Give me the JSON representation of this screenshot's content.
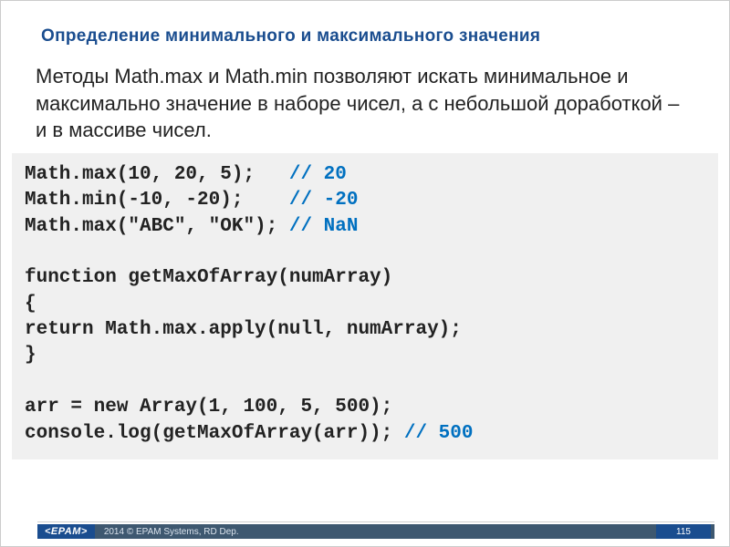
{
  "title": "Определение минимального и максимального значения",
  "body": "Методы Math.max и Math.min позволяют искать минимальное и максимально значение в наборе чисел, а с небольшой доработкой – и в массиве чисел.",
  "code": {
    "l1a": "Math.max(10, 20, 5);   ",
    "l1c": "// 20",
    "l2a": "Math.min(-10, -20);    ",
    "l2c": "// -20",
    "l3a": "Math.max(\"ABC\", \"OK\"); ",
    "l3c": "// NaN",
    "l4": "",
    "l5": "function getMaxOfArray(numArray)",
    "l6": "{",
    "l7": "return Math.max.apply(null, numArray);",
    "l8": "}",
    "l9": "",
    "l10": "arr = new Array(1, 100, 5, 500);",
    "l11a": "console.log(getMaxOfArray(arr)); ",
    "l11c": "// 500"
  },
  "footer": {
    "logo": "<EPAM>",
    "text": "2014 © EPAM Systems, RD Dep.",
    "page": "115"
  }
}
